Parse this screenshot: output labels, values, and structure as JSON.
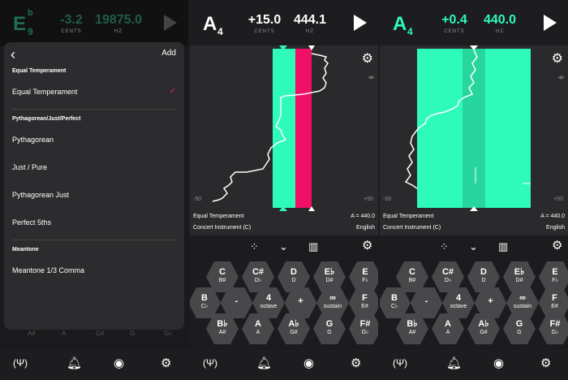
{
  "colors": {
    "accent": "#2efbb9",
    "accent_dark": "#1f6e55",
    "red": "#f01066",
    "check": "#e0207a"
  },
  "panel1": {
    "header": {
      "note": "E",
      "octave": "9",
      "accidental": "b",
      "cents": "-3.2",
      "cents_unit": "CENTS",
      "hz": "19875.0",
      "hz_unit": "HZ"
    },
    "sheet": {
      "back_label": "‹",
      "add_label": "Add",
      "sections": [
        {
          "title": "Equal Temperament",
          "items": [
            {
              "label": "Equal Temperament",
              "checked": true
            }
          ]
        },
        {
          "title": "Pythagorean/Just/Perfect",
          "items": [
            {
              "label": "Pythagorean"
            },
            {
              "label": "Just / Pure"
            },
            {
              "label": "Pythagorean Just"
            },
            {
              "label": "Perfect 5ths"
            }
          ]
        },
        {
          "title": "Meantone",
          "items": [
            {
              "label": "Meantone 1/3 Comma"
            }
          ]
        }
      ],
      "checkmark": "✓"
    },
    "dim_keys": [
      "A#",
      "A",
      "G#",
      "G",
      "G♭"
    ]
  },
  "panel2": {
    "header": {
      "note": "A",
      "octave": "4",
      "cents": "+15.0",
      "cents_unit": "CENTS",
      "hz": "444.1",
      "hz_unit": "HZ"
    },
    "scale_left": "-50",
    "scale_right": "+50",
    "temperament": "Equal Temperament",
    "a_ref": "A = 440.0",
    "instrument": "Concert Instrument (C)",
    "language": "English"
  },
  "panel3": {
    "header": {
      "note": "A",
      "octave": "4",
      "cents": "+0.4",
      "cents_unit": "CENTS",
      "hz": "440.0",
      "hz_unit": "HZ"
    },
    "scale_left": "-50",
    "scale_right": "+50",
    "temperament": "Equal Temperament",
    "a_ref": "A = 440.0",
    "instrument": "Concert Instrument (C)",
    "language": "English"
  },
  "keys": {
    "row1": [
      {
        "a": "C",
        "b": "B#"
      },
      {
        "a": "C#",
        "b": "D♭"
      },
      {
        "a": "D",
        "b": "D"
      },
      {
        "a": "E♭",
        "b": "D#"
      },
      {
        "a": "E",
        "b": "F♭"
      }
    ],
    "row2": [
      {
        "a": "B",
        "b": "C♭"
      },
      {
        "a": "-",
        "b": ""
      },
      {
        "a": "4",
        "b": "octave"
      },
      {
        "a": "+",
        "b": ""
      },
      {
        "a": "∞",
        "b": "sustain"
      },
      {
        "a": "F",
        "b": "E#"
      }
    ],
    "row3": [
      {
        "a": "B♭",
        "b": "A#"
      },
      {
        "a": "A",
        "b": "A"
      },
      {
        "a": "A♭",
        "b": "G#"
      },
      {
        "a": "G",
        "b": "G"
      },
      {
        "a": "F#",
        "b": "G♭"
      }
    ]
  },
  "icons": {
    "gear": "⚙",
    "wave": "◂▸",
    "dots": "⁘",
    "chevron": "⌄",
    "piano": "▥",
    "tuner": "(Ψ)",
    "bell": "🔔︎",
    "target": "◉",
    "settings": "⚙"
  }
}
